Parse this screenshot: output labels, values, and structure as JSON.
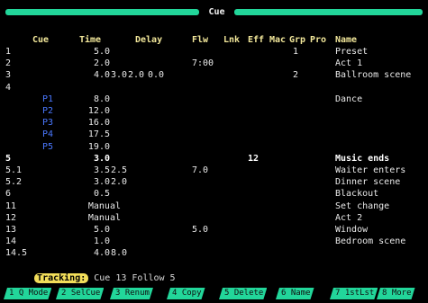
{
  "title": "Cue",
  "columns": {
    "cue": "Cue",
    "time": "Time",
    "delay": "Delay",
    "flw": "Flw",
    "lnk": "Lnk",
    "eff": "Eff",
    "mac": "Mac",
    "grp": "Grp",
    "pro": "Pro",
    "name": "Name"
  },
  "rows": [
    {
      "cue": "1",
      "part": "",
      "t1": "5.0",
      "t2": "",
      "d1": "",
      "d2": "",
      "flw": "",
      "eff": "",
      "grp": "1",
      "name": "Preset",
      "style": ""
    },
    {
      "cue": "2",
      "part": "",
      "t1": "2.0",
      "t2": "",
      "d1": "",
      "d2": "",
      "flw": "7:00",
      "eff": "",
      "grp": "",
      "name": "Act 1",
      "style": ""
    },
    {
      "cue": "3",
      "part": "",
      "t1": "4.0",
      "t2": "3.0",
      "d1": "2.0",
      "d2": "0.0",
      "flw": "",
      "eff": "",
      "grp": "2",
      "name": "Ballroom scene",
      "style": ""
    },
    {
      "cue": "4",
      "part": "",
      "t1": "",
      "t2": "",
      "d1": "",
      "d2": "",
      "flw": "",
      "eff": "",
      "grp": "",
      "name": "",
      "style": ""
    },
    {
      "cue": "",
      "part": "P1",
      "t1": "8.0",
      "t2": "",
      "d1": "",
      "d2": "",
      "flw": "",
      "eff": "",
      "grp": "",
      "name": "Dance",
      "style": "part"
    },
    {
      "cue": "",
      "part": "P2",
      "t1": "12.0",
      "t2": "",
      "d1": "",
      "d2": "",
      "flw": "",
      "eff": "",
      "grp": "",
      "name": "",
      "style": "part"
    },
    {
      "cue": "",
      "part": "P3",
      "t1": "16.0",
      "t2": "",
      "d1": "",
      "d2": "",
      "flw": "",
      "eff": "",
      "grp": "",
      "name": "",
      "style": "part"
    },
    {
      "cue": "",
      "part": "P4",
      "t1": "17.5",
      "t2": "",
      "d1": "",
      "d2": "",
      "flw": "",
      "eff": "",
      "grp": "",
      "name": "",
      "style": "part"
    },
    {
      "cue": "",
      "part": "P5",
      "t1": "19.0",
      "t2": "",
      "d1": "",
      "d2": "",
      "flw": "",
      "eff": "",
      "grp": "",
      "name": "",
      "style": "part"
    },
    {
      "cue": "5",
      "part": "",
      "t1": "3.0",
      "t2": "",
      "d1": "",
      "d2": "",
      "flw": "",
      "eff": "12",
      "grp": "",
      "name": "Music ends",
      "style": "bold"
    },
    {
      "cue": "5.1",
      "part": "",
      "t1": "3.5",
      "t2": "2.5",
      "d1": "",
      "d2": "",
      "flw": "7.0",
      "eff": "",
      "grp": "",
      "name": "Waiter enters",
      "style": ""
    },
    {
      "cue": "5.2",
      "part": "",
      "t1": "3.0",
      "t2": "2.0",
      "d1": "",
      "d2": "",
      "flw": "",
      "eff": "",
      "grp": "",
      "name": "Dinner scene",
      "style": ""
    },
    {
      "cue": "6",
      "part": "",
      "t1": "0.5",
      "t2": "",
      "d1": "",
      "d2": "",
      "flw": "",
      "eff": "",
      "grp": "",
      "name": "Blackout",
      "style": ""
    },
    {
      "cue": "11",
      "part": "",
      "t1": "Manual",
      "t2": "",
      "d1": "",
      "d2": "",
      "flw": "",
      "eff": "",
      "grp": "",
      "name": "Set change",
      "style": ""
    },
    {
      "cue": "12",
      "part": "",
      "t1": "Manual",
      "t2": "",
      "d1": "",
      "d2": "",
      "flw": "",
      "eff": "",
      "grp": "",
      "name": "Act 2",
      "style": ""
    },
    {
      "cue": "13",
      "part": "",
      "t1": "5.0",
      "t2": "",
      "d1": "",
      "d2": "",
      "flw": "5.0",
      "eff": "",
      "grp": "",
      "name": "Window",
      "style": ""
    },
    {
      "cue": "14",
      "part": "",
      "t1": "1.0",
      "t2": "",
      "d1": "",
      "d2": "",
      "flw": "",
      "eff": "",
      "grp": "",
      "name": "Bedroom scene",
      "style": ""
    },
    {
      "cue": "14.5",
      "part": "",
      "t1": "4.0",
      "t2": "8.0",
      "d1": "",
      "d2": "",
      "flw": "",
      "eff": "",
      "grp": "",
      "name": "",
      "style": ""
    }
  ],
  "tracking": {
    "label": "Tracking:",
    "status": "Cue 13 Follow 5"
  },
  "softkeys": [
    "1 Q Mode",
    "2 SelCue",
    "3 Renum",
    "4 Copy",
    "5 Delete",
    "6 Name",
    "7 1stLst",
    "8 More"
  ],
  "colors": {
    "accent": "#22d69a",
    "tracking_badge": "#f2de5a",
    "part_text": "#4a78ff",
    "header_text": "#f2e79a"
  }
}
